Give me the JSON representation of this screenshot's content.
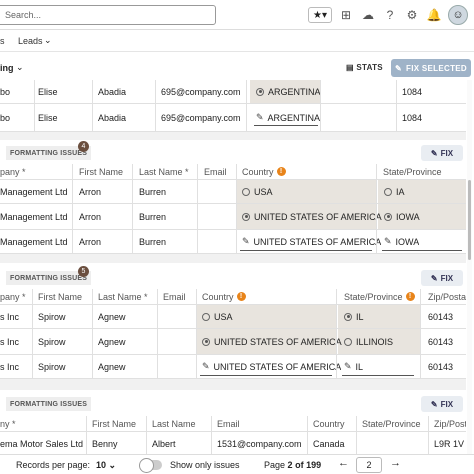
{
  "topbar": {
    "search_placeholder": "Search...",
    "icons": [
      "star-icon",
      "plus-square-icon",
      "cloud-icon",
      "help-icon",
      "gear-icon",
      "bell-icon",
      "avatar"
    ]
  },
  "tabs": {
    "first": "s",
    "second": "Leads"
  },
  "actions": {
    "selection": "ing",
    "stats": "STATS",
    "fix_selected": "FIX SELECTED"
  },
  "colors": {
    "accent": "#9fb3c8",
    "badge": "#6b4f3f",
    "info": "#e8841a",
    "shade": "#e8e4de"
  },
  "top_rows": [
    {
      "c0": "bo",
      "first": "Elise",
      "last": "Abadia",
      "email": "695@company.com",
      "country": "ARGENTINA",
      "zip": "1084"
    },
    {
      "c0": "bo",
      "first": "Elise",
      "last": "Abadia",
      "email": "695@company.com",
      "country": "ARGENTINA",
      "zip": "1084"
    }
  ],
  "group1": {
    "label": "FORMATTING ISSUES",
    "count": "4",
    "fix": "FIX",
    "headers": {
      "company": "pany *",
      "first": "First Name",
      "last": "Last Name *",
      "email": "Email",
      "country": "Country",
      "state": "State/Province"
    },
    "rows": [
      {
        "company": "Management Ltd",
        "first": "Arron",
        "last": "Burren",
        "email": "",
        "country": "USA",
        "state": "IA"
      },
      {
        "company": "Management Ltd",
        "first": "Arron",
        "last": "Burren",
        "email": "",
        "country": "UNITED STATES OF AMERICA",
        "state": "IOWA"
      },
      {
        "company": "Management Ltd",
        "first": "Arron",
        "last": "Burren",
        "email": "",
        "country": "UNITED STATES OF AMERICA",
        "state": "IOWA"
      }
    ]
  },
  "group2": {
    "label": "FORMATTING ISSUES",
    "count": "5",
    "fix": "FIX",
    "headers": {
      "company": "pany *",
      "first": "First Name",
      "last": "Last Name *",
      "email": "Email",
      "country": "Country",
      "state": "State/Province",
      "zip": "Zip/Posta"
    },
    "rows": [
      {
        "company": "s Inc",
        "first": "Spirow",
        "last": "Agnew",
        "email": "",
        "country": "USA",
        "state": "IL",
        "zip": "60143"
      },
      {
        "company": "s Inc",
        "first": "Spirow",
        "last": "Agnew",
        "email": "",
        "country": "UNITED STATES OF AMERICA",
        "state": "ILLINOIS",
        "zip": "60143"
      },
      {
        "company": "s Inc",
        "first": "Spirow",
        "last": "Agnew",
        "email": "",
        "country": "UNITED STATES OF AMERICA",
        "state": "IL",
        "zip": "60143"
      }
    ]
  },
  "group3": {
    "label": "FORMATTING ISSUES",
    "fix": "FIX",
    "headers": {
      "company": "ny *",
      "first": "First Name",
      "last": "Last Name",
      "email": "Email",
      "country": "Country",
      "state": "State/Province",
      "zip": "Zip/Posta"
    },
    "rows": [
      {
        "company": "ema Motor Sales Ltd",
        "first": "Benny",
        "last": "Albert",
        "email": "1531@company.com",
        "country": "Canada",
        "state": "",
        "zip": "L9R 1V"
      }
    ]
  },
  "footer": {
    "records_label": "Records per page:",
    "records_value": "10",
    "show_only": "Show only issues",
    "page_prefix": "Page",
    "page_current": "2",
    "page_of": "of",
    "page_total": "199",
    "page_input": "2"
  }
}
